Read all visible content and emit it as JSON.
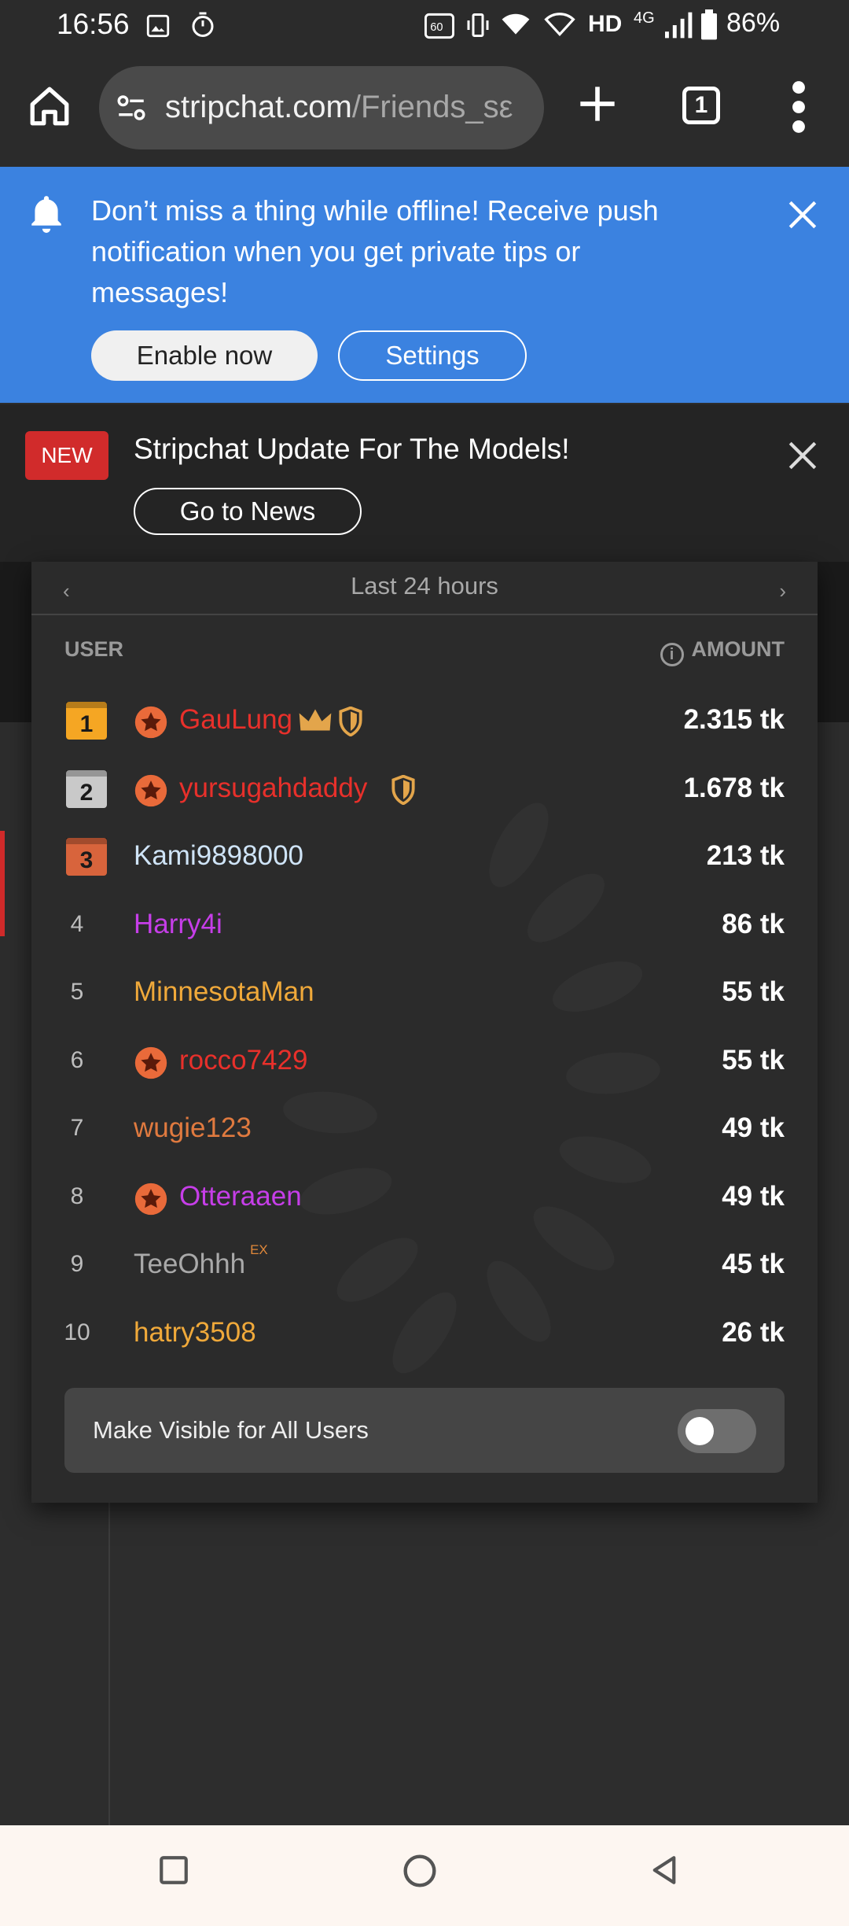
{
  "status_bar": {
    "time": "16:56",
    "network": "HD",
    "network_gen": "4G",
    "battery": "86%"
  },
  "browser": {
    "url_host": "stripchat.com",
    "url_path": "/Friends_sε",
    "tab_count": "1"
  },
  "push_banner": {
    "message": "Don’t miss a thing while offline! Receive push notification when you get private tips or messages!",
    "enable_label": "Enable now",
    "settings_label": "Settings"
  },
  "news_banner": {
    "badge": "NEW",
    "title": "Stripchat Update For The Models!",
    "button_label": "Go to News"
  },
  "leaderboard": {
    "period": "Last 24 hours",
    "col_user": "USER",
    "col_amount": "AMOUNT",
    "rows": [
      {
        "rank": "1",
        "name": "GauLung",
        "amount": "2.315 tk",
        "color": "#e8302b",
        "star": true,
        "crown": true,
        "shield": true
      },
      {
        "rank": "2",
        "name": "yursugahdaddy",
        "amount": "1.678 tk",
        "color": "#e8302b",
        "star": true,
        "crown": false,
        "shield": true
      },
      {
        "rank": "3",
        "name": "Kami9898000",
        "amount": "213 tk",
        "color": "#cfe4f7",
        "star": false
      },
      {
        "rank": "4",
        "name": "Harry4i",
        "amount": "86 tk",
        "color": "#c63ee8",
        "star": false
      },
      {
        "rank": "5",
        "name": "MinnesotaMan",
        "amount": "55 tk",
        "color": "#f0a93a",
        "star": false
      },
      {
        "rank": "6",
        "name": "rocco7429",
        "amount": "55 tk",
        "color": "#e8302b",
        "star": true
      },
      {
        "rank": "7",
        "name": "wugie123",
        "amount": "49 tk",
        "color": "#e07a3f",
        "star": false
      },
      {
        "rank": "8",
        "name": "Otteraaen",
        "amount": "49 tk",
        "color": "#c63ee8",
        "star": true
      },
      {
        "rank": "9",
        "name": "TeeOhhh",
        "amount": "45 tk",
        "color": "#a9a9a9",
        "star": false,
        "ex": "EX"
      },
      {
        "rank": "10",
        "name": "hatry3508",
        "amount": "26 tk",
        "color": "#f0a93a",
        "star": false
      }
    ],
    "visible_label": "Make Visible for All Users",
    "visible_toggle_on": false
  },
  "colors": {
    "push_blue": "#3b82e0",
    "news_red": "#d12b2b",
    "medal_gold": "#f5a623",
    "medal_silver": "#c9c9c9",
    "medal_bronze": "#d8643c"
  }
}
